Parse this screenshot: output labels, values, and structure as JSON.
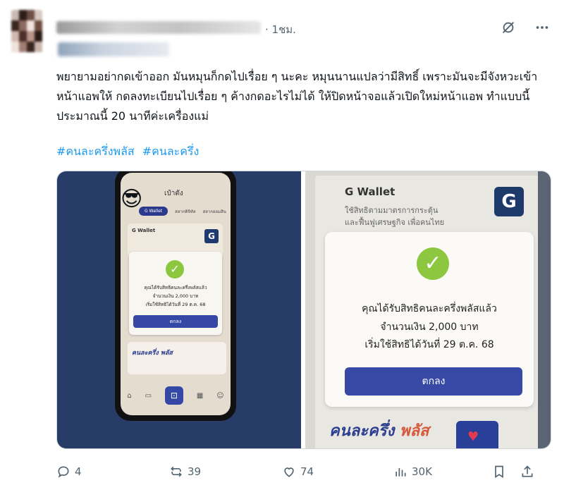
{
  "post": {
    "time": "· 1ชม.",
    "text": "พยายามอย่ากดเข้าออก มันหมุนก็กดไปเรื่อย ๆ นะคะ หมุนนานแปลว่ามีสิทธิ์ เพราะมันจะมีจังหวะเข้าหน้าแอพให้ กดลงทะเบียนไปเรื่อย ๆ ค้างกดอะไรไม่ได้ ให้ปิดหน้าจอแล้วเปิดใหม่หน้าแอพ ทำแบบนี้ประมาณนี้ 20 นาทีค่ะเครื่องแม่",
    "hashtags": [
      "#คนละครึ่งพลัส",
      "#คนละครึ่ง"
    ]
  },
  "left_image": {
    "app_title": "เป๋าตัง",
    "tab_active": "G Wallet",
    "tab_2": "สลากดิจิทัล",
    "tab_3": "สลากออมสิน",
    "card_title": "G Wallet",
    "dialog_line1": "คุณได้รับสิทธิคนละครึ่งพลัสแล้ว",
    "dialog_line2": "จำนวนเงิน 2,000 บาท",
    "dialog_line3": "เริ่มใช้สิทธิได้วันที่ 29 ต.ค. 68",
    "ok": "ตกลง",
    "banner": "คนละครึ่ง พลัส"
  },
  "right_image": {
    "card_title": "G Wallet",
    "card_sub1": "ใช้สิทธิตามมาตรการกระตุ้น",
    "card_sub2": "และฟื้นฟูเศรษฐกิจ เพื่อคนไทย",
    "dialog_line1": "คุณได้รับสิทธิคนละครึ่งพลัสแล้ว",
    "dialog_line2": "จำนวนเงิน 2,000 บาท",
    "dialog_line3": "เริ่มใช้สิทธิได้วันที่ 29 ต.ค. 68",
    "ok": "ตกลง",
    "banner_a": "คนละครึ่ง",
    "banner_b": "พลัส"
  },
  "actions": {
    "replies": "4",
    "reposts": "39",
    "likes": "74",
    "views": "30K"
  }
}
